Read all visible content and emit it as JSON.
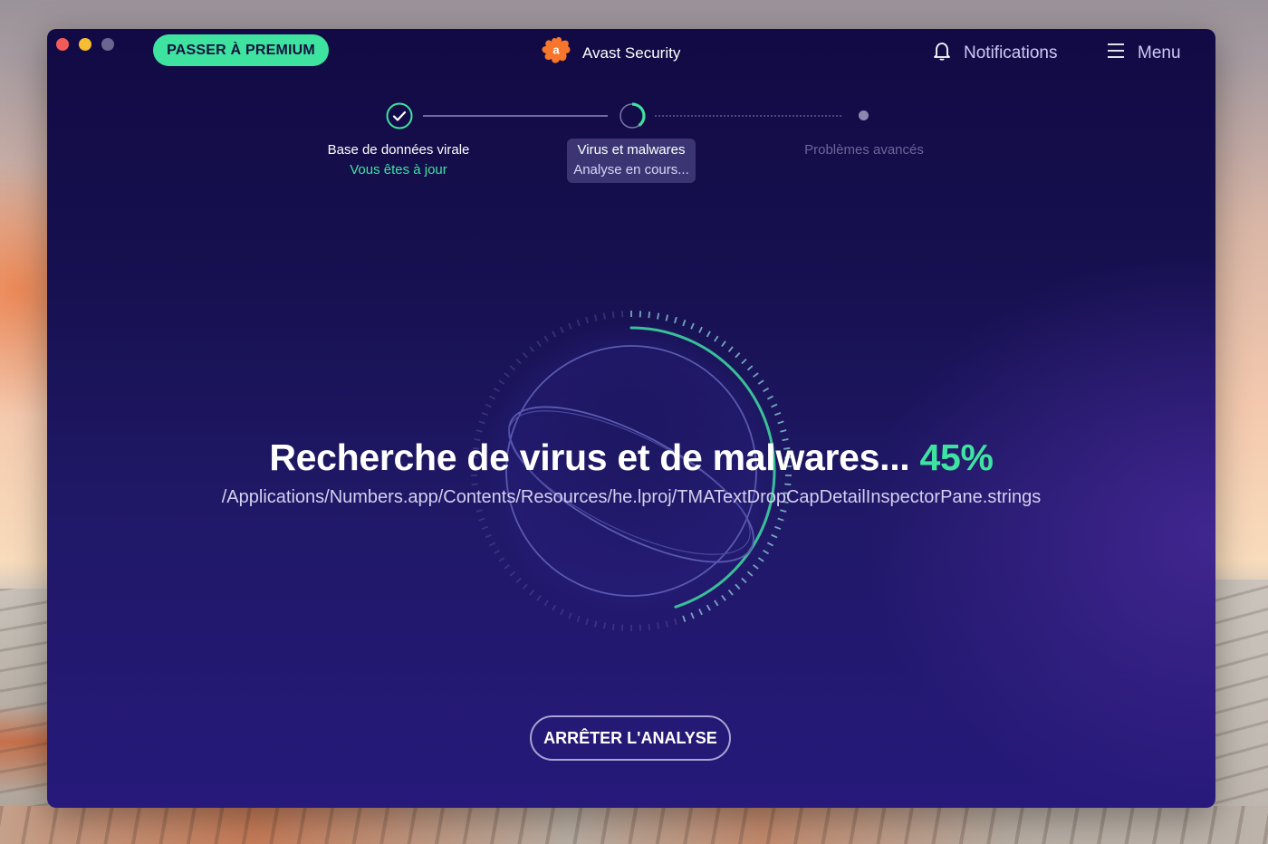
{
  "window": {
    "title": "Avast Security",
    "traffic_lights": [
      "close",
      "minimize",
      "maximize"
    ]
  },
  "header": {
    "premium_button": "PASSER À PREMIUM",
    "brand_title": "Avast Security",
    "brand_icon": "avast-logo-icon",
    "notifications_label": "Notifications",
    "notifications_icon": "bell-icon",
    "menu_label": "Menu",
    "menu_icon": "hamburger-icon"
  },
  "stepper": {
    "steps": [
      {
        "title": "Base de données virale",
        "subtitle": "Vous êtes à jour",
        "state": "done",
        "icon": "check-circle-icon"
      },
      {
        "title": "Virus et malwares",
        "subtitle": "Analyse en cours...",
        "state": "active",
        "icon": "spinner-icon"
      },
      {
        "title": "Problèmes avancés",
        "subtitle": "",
        "state": "pending",
        "icon": "dot-icon"
      }
    ]
  },
  "scan": {
    "headline": "Recherche de virus et de malwares...",
    "percent_label": "45%",
    "progress": 0.45,
    "current_file": "/Applications/Numbers.app/Contents/Resources/he.lproj/TMATextDropCapDetailInspectorPane.strings"
  },
  "actions": {
    "stop_button": "ARRÊTER L'ANALYSE"
  },
  "colors": {
    "accent_green": "#3fe3a0",
    "window_bg": "#16104f",
    "avast_orange": "#f7762b",
    "close": "#f35b5b",
    "minimize": "#f7bd30"
  }
}
